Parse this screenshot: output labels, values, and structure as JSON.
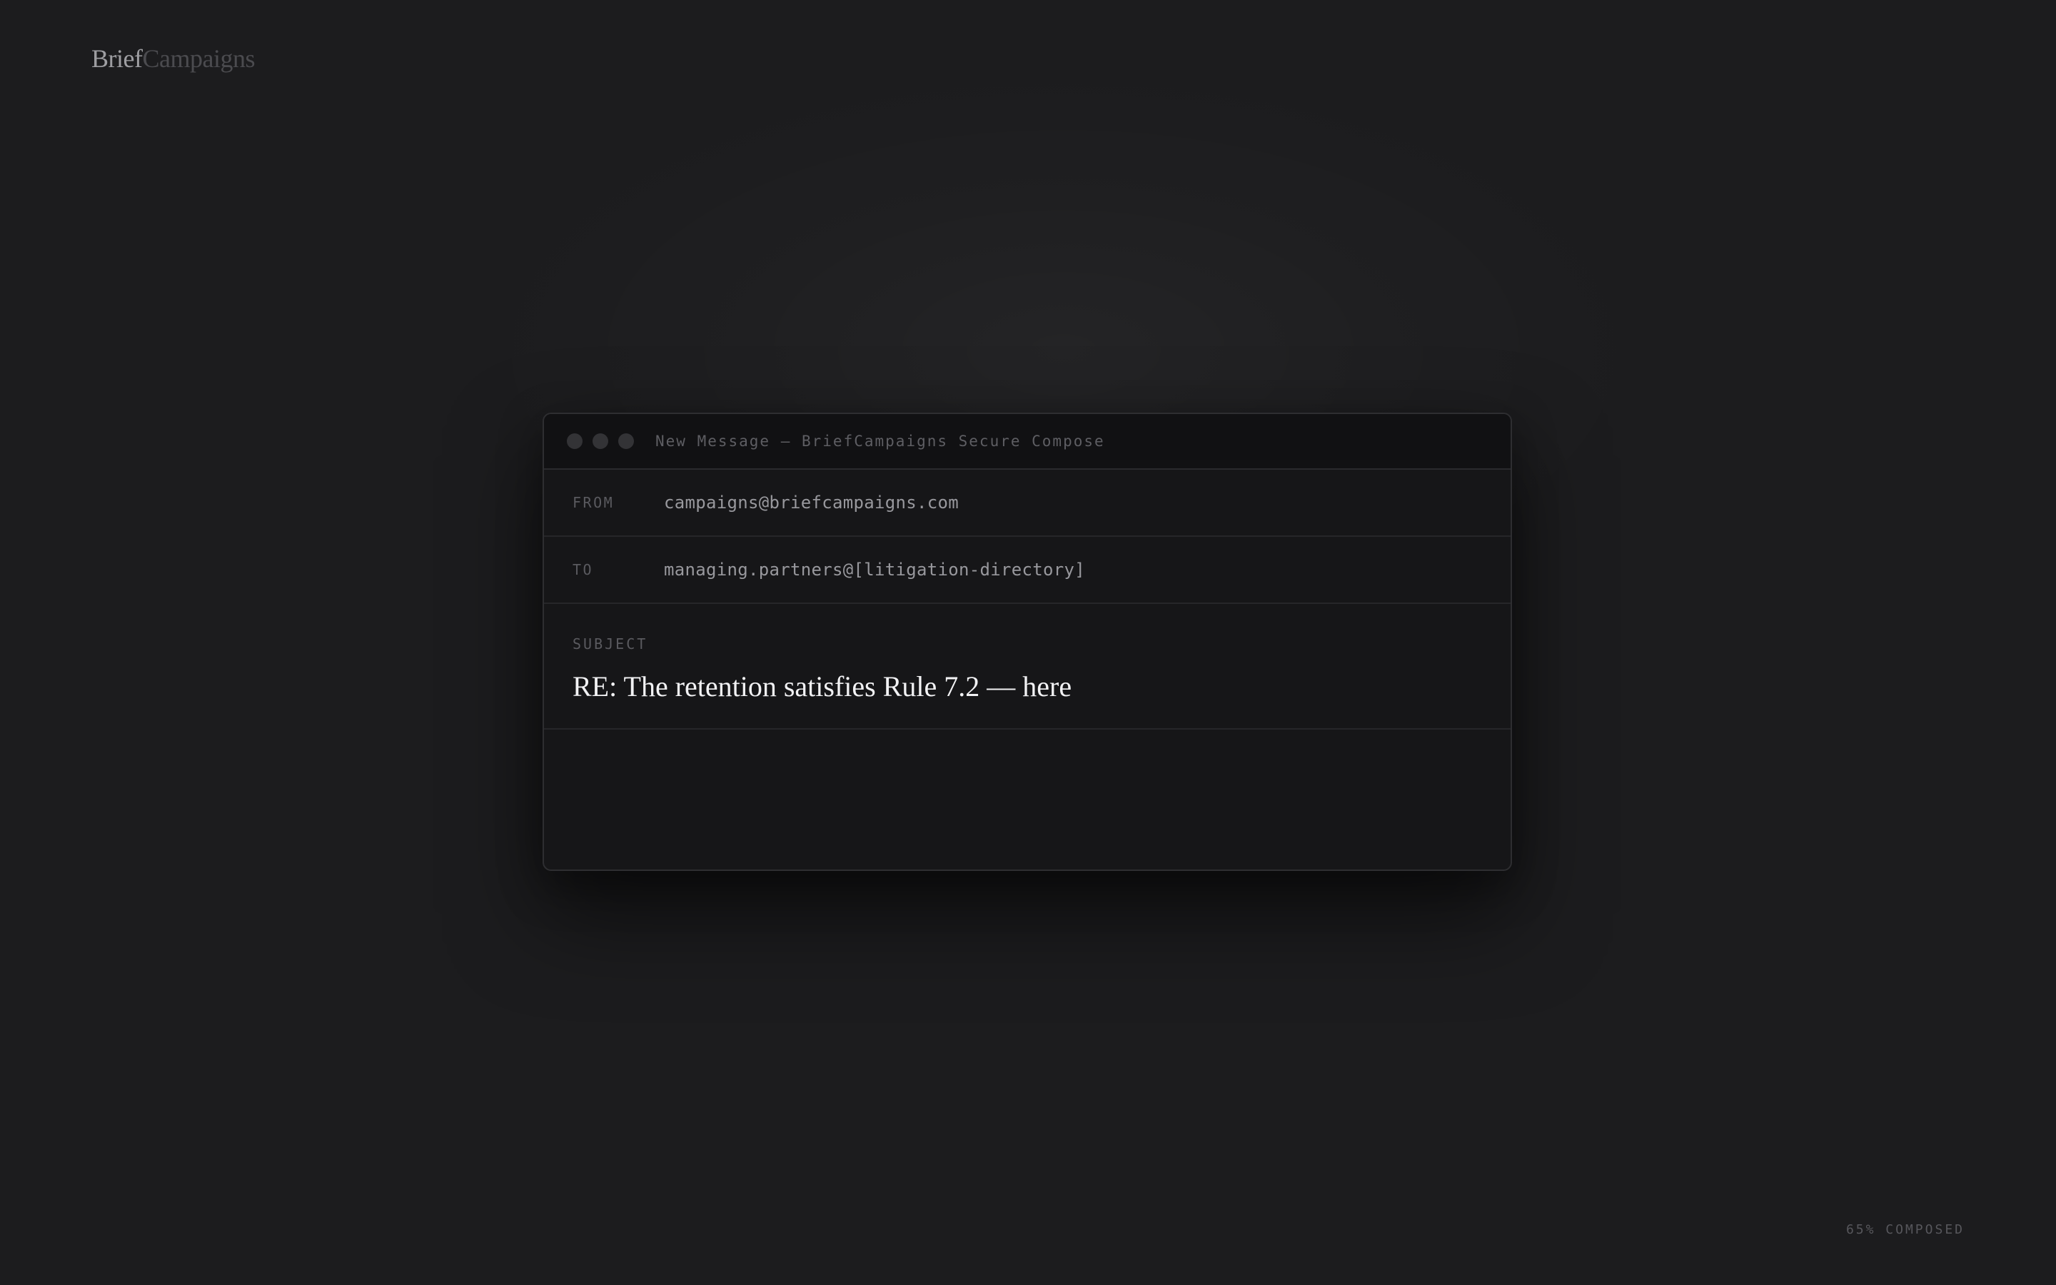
{
  "logo": {
    "brand_primary": "Brief",
    "brand_secondary": "Campaigns"
  },
  "window": {
    "title": "New Message — BriefCampaigns Secure Compose",
    "controls": [
      "close-dot",
      "minimize-dot",
      "maximize-dot"
    ]
  },
  "compose": {
    "from_label": "FROM",
    "from_value": "campaigns@briefcampaigns.com",
    "to_label": "TO",
    "to_value": "managing.partners@[litigation-directory]",
    "subject_label": "SUBJECT",
    "subject_value": "RE: The retention satisfies Rule 7.2 — here",
    "body_value": ""
  },
  "status": {
    "progress_text": "65% COMPOSED",
    "progress_fraction": 0.65
  },
  "colors": {
    "background": "#1c1c1e",
    "window_bg": "#161618",
    "titlebar_bg": "#111113",
    "subject_text": "#f2f2f4",
    "muted_text": "#5a5a5f"
  }
}
